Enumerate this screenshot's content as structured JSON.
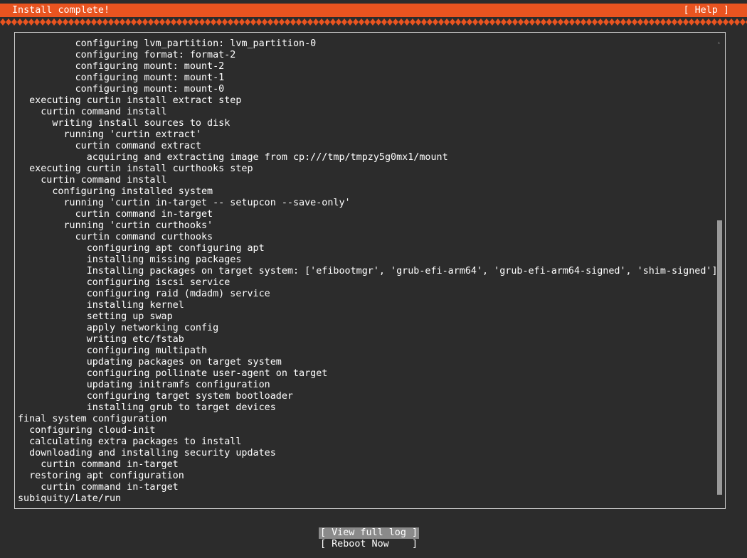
{
  "header": {
    "title": "Install complete!",
    "help_label": "[ Help ]"
  },
  "log": {
    "lines": [
      "          configuring lvm_partition: lvm_partition-0",
      "          configuring format: format-2",
      "          configuring mount: mount-2",
      "          configuring mount: mount-1",
      "          configuring mount: mount-0",
      "  executing curtin install extract step",
      "    curtin command install",
      "      writing install sources to disk",
      "        running 'curtin extract'",
      "          curtin command extract",
      "            acquiring and extracting image from cp:///tmp/tmpzy5g0mx1/mount",
      "  executing curtin install curthooks step",
      "    curtin command install",
      "      configuring installed system",
      "        running 'curtin in-target -- setupcon --save-only'",
      "          curtin command in-target",
      "        running 'curtin curthooks'",
      "          curtin command curthooks",
      "            configuring apt configuring apt",
      "            installing missing packages",
      "            Installing packages on target system: ['efibootmgr', 'grub-efi-arm64', 'grub-efi-arm64-signed', 'shim-signed']",
      "            configuring iscsi service",
      "            configuring raid (mdadm) service",
      "            installing kernel",
      "            setting up swap",
      "            apply networking config",
      "            writing etc/fstab",
      "            configuring multipath",
      "            updating packages on target system",
      "            configuring pollinate user-agent on target",
      "            updating initramfs configuration",
      "            configuring target system bootloader",
      "            installing grub to target devices",
      "final system configuration",
      "  configuring cloud-init",
      "  calculating extra packages to install",
      "  downloading and installing security updates",
      "    curtin command in-target",
      "  restoring apt configuration",
      "    curtin command in-target",
      "subiquity/Late/run"
    ],
    "scroll_up_glyph": "▴"
  },
  "actions": {
    "view_log_label": "[ View full log ]",
    "reboot_label": "[ Reboot Now    ]"
  },
  "colors": {
    "accent": "#e95420",
    "background": "#2c2c2c",
    "focus": "#8a8a8a"
  }
}
